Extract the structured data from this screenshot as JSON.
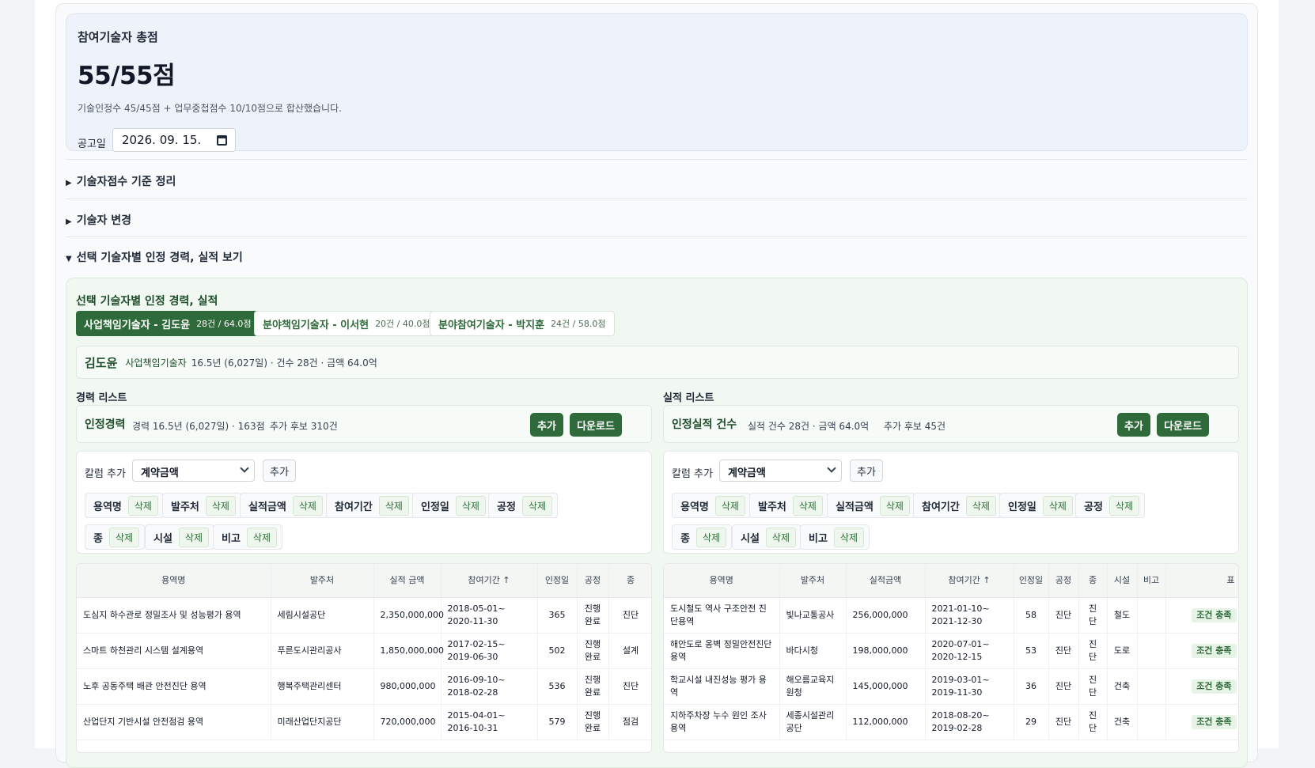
{
  "score": {
    "title": "참여기술자 총점",
    "value": "55/55점",
    "desc": "기술인정수 45/45점 + 업무중첩점수 10/10점으로 합산했습니다.",
    "date_label": "공고일",
    "date_value": "2026. 09. 15."
  },
  "sections": {
    "s1": "기술자점수 기준 정리",
    "s2": "기술자 변경",
    "s3": "선택 기술자별 인정 경력, 실적 보기"
  },
  "panel": {
    "title": "선택 기술자별 인정 경력, 실적",
    "tabs": [
      {
        "label": "사업책임기술자 - 김도윤",
        "count": "28건 / 64.0점"
      },
      {
        "label": "분야책임기술자 - 이서현",
        "count": "20건 / 40.0점"
      },
      {
        "label": "분야참여기술자 - 박지훈",
        "count": "24건 / 58.0점"
      }
    ],
    "person": {
      "name": "김도윤",
      "role": "사업책임기술자",
      "info": "16.5년 (6,027일) · 건수 28건 · 금액 64.0억"
    }
  },
  "career": {
    "section_title": "경력 리스트",
    "label": "인정경력",
    "info": "경력 16.5년 (6,027일) · 163점",
    "extra": "추가 후보 310건",
    "add_label": "추가",
    "download_label": "다운로드",
    "col_add_label": "칼럼 추가",
    "select_value": "계약금액",
    "col_add_button": "추가",
    "delete_label": "삭제",
    "chips": [
      "용역명",
      "발주처",
      "실적금액",
      "참여기간",
      "인정일",
      "공정",
      "종",
      "시설",
      "비고"
    ],
    "headers": [
      "용역명",
      "발주처",
      "실적 금액",
      "참여기간 ↑",
      "인정일",
      "공정",
      "종"
    ],
    "rows": [
      [
        "도심지 하수관로 정밀조사 및 성능평가 용역",
        "세림시설공단",
        "2,350,000,000",
        "2018-05-01~ 2020-11-30",
        "365",
        "진행 완료",
        "진단"
      ],
      [
        "스마트 하천관리 시스템 설계용역",
        "푸른도시관리공사",
        "1,850,000,000",
        "2017-02-15~ 2019-06-30",
        "502",
        "진행 완료",
        "설계"
      ],
      [
        "노후 공동주택 배관 안전진단 용역",
        "행복주택관리센터",
        "980,000,000",
        "2016-09-10~ 2018-02-28",
        "536",
        "진행 완료",
        "진단"
      ],
      [
        "산업단지 기반시설 안전점검 용역",
        "미래산업단지공단",
        "720,000,000",
        "2015-04-01~ 2016-10-31",
        "579",
        "진행 완료",
        "점검"
      ]
    ]
  },
  "record": {
    "section_title": "실적 리스트",
    "label": "인정실적 건수",
    "info": "실적 건수 28건 · 금액 64.0억",
    "extra": "추가 후보 45건",
    "add_label": "추가",
    "download_label": "다운로드",
    "col_add_label": "칼럼 추가",
    "select_value": "계약금액",
    "col_add_button": "추가",
    "delete_label": "삭제",
    "chips": [
      "용역명",
      "발주처",
      "실적금액",
      "참여기간",
      "인정일",
      "공정",
      "종",
      "시설",
      "비고"
    ],
    "headers": [
      "용역명",
      "발주처",
      "실적금액",
      "참여기간 ↑",
      "인정일",
      "공정",
      "종",
      "시설",
      "비고",
      "표"
    ],
    "rows": [
      [
        "도시철도 역사 구조안전 진단용역",
        "빛나교통공사",
        "256,000,000",
        "2021-01-10~ 2021-12-30",
        "58",
        "진단",
        "진단",
        "철도",
        "",
        "조건 충족"
      ],
      [
        "해안도로 옹벽 정밀안전진단 용역",
        "바다시청",
        "198,000,000",
        "2020-07-01~ 2020-12-15",
        "53",
        "진단",
        "진단",
        "도로",
        "",
        "조건 충족"
      ],
      [
        "학교시설 내진성능 평가 용역",
        "해오름교육지원청",
        "145,000,000",
        "2019-03-01~ 2019-11-30",
        "36",
        "진단",
        "진단",
        "건축",
        "",
        "조건 충족"
      ],
      [
        "지하주차장 누수 원인 조사 용역",
        "세종시설관리공단",
        "112,000,000",
        "2018-08-20~ 2019-02-28",
        "29",
        "진단",
        "진단",
        "건축",
        "",
        "조건 충족"
      ]
    ]
  }
}
